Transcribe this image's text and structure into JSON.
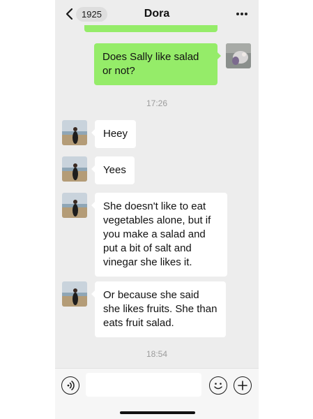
{
  "header": {
    "unread_count": "1925",
    "title": "Dora"
  },
  "messages": [
    {
      "from": "me",
      "text": "Does Sally like salad or not?"
    },
    {
      "from": "contact",
      "text": "Heey"
    },
    {
      "from": "contact",
      "text": "Yees"
    },
    {
      "from": "contact",
      "text": "She doesn't like to eat vegetables alone, but if you make a salad and put a bit of salt and vinegar she likes it."
    },
    {
      "from": "contact",
      "text": "Or because she said she likes fruits. She than eats fruit salad."
    }
  ],
  "timestamps": [
    "17:26",
    "18:54"
  ],
  "composer": {
    "value": "",
    "placeholder": ""
  },
  "icons": [
    "back-chevron-icon",
    "more-dots-icon",
    "voice-icon",
    "emoji-icon",
    "plus-icon"
  ],
  "colors": {
    "sent_bubble": "#95ec69",
    "received_bubble": "#ffffff",
    "chat_background": "#ededed"
  }
}
